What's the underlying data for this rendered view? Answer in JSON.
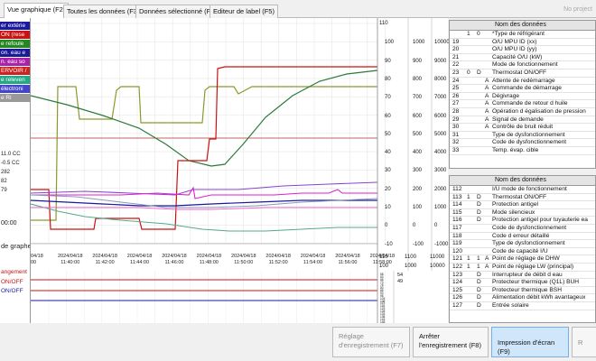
{
  "tabs": [
    {
      "label": "Vue graphique (F2)",
      "active": true
    },
    {
      "label": "Toutes les données (F3)",
      "active": false
    },
    {
      "label": "Données sélectionné (F4)",
      "active": false
    },
    {
      "label": "Editeur de label (F5)",
      "active": false
    }
  ],
  "no_project": "No project",
  "left_legend": [
    {
      "text": "er extérie",
      "color": "#1a1aa0"
    },
    {
      "text": "ON (rese",
      "color": "#cc1111"
    },
    {
      "text": "e refoule",
      "color": "#228822"
    },
    {
      "text": "on. eau e",
      "color": "#1a1a99"
    },
    {
      "text": "n. eau so",
      "color": "#aa22aa"
    },
    {
      "text": "ERVOIR /",
      "color": "#cc2222"
    },
    {
      "text": "e releven",
      "color": "#22aa88"
    },
    {
      "text": "électroni",
      "color": "#4444cc"
    },
    {
      "text": "e Ri",
      "color": "#999999"
    }
  ],
  "left_small": [
    "11.0 CC",
    "-0.5 CC",
    "282",
    "82",
    "79"
  ],
  "left_time": "00:00",
  "left_label": "de graphe",
  "left_bottom": [
    {
      "text": "angement",
      "color": "#cc1111"
    },
    {
      "text": "ON/OFF",
      "color": "#cc1111"
    },
    {
      "text": "ON/OFF",
      "color": "#1a1aa0"
    }
  ],
  "right_axis_1": [
    "110",
    "100",
    "90",
    "80",
    "70",
    "60",
    "50",
    "40",
    "30",
    "20",
    "10",
    "0",
    "-10"
  ],
  "right_axis_2": [
    "110",
    "1100",
    "11000"
  ],
  "right_axis_3": [
    "100",
    "1000",
    "10000"
  ],
  "time_labels": [
    {
      "date": "2024/04/18",
      "time": "11:40:00"
    },
    {
      "date": "2024/04/18",
      "time": "11:42:00"
    },
    {
      "date": "2024/04/18",
      "time": "11:44:00"
    },
    {
      "date": "2024/04/18",
      "time": "11:46:00"
    },
    {
      "date": "2024/04/18",
      "time": "11:48:00"
    },
    {
      "date": "2024/04/18",
      "time": "11:50:00"
    },
    {
      "date": "2024/04/18",
      "time": "11:52:00"
    },
    {
      "date": "2024/04/18",
      "time": "11:54:00"
    },
    {
      "date": "2024/04/18",
      "time": "11:56:00"
    },
    {
      "date": "2024/04/18",
      "time": "11:58:00"
    }
  ],
  "time_left_partial": {
    "date": "04/18",
    "time": "00"
  },
  "lower_axis": [
    "58",
    "63",
    "68",
    "73",
    "78",
    "83",
    "88",
    "93",
    "98",
    "103",
    "108",
    "113",
    "118",
    "123",
    "128",
    "133",
    "138",
    "143",
    "148"
  ],
  "lower_side": [
    "54",
    "49"
  ],
  "table1": {
    "header": "Nom des données",
    "rows": [
      {
        "n": "",
        "a": "1",
        "b": "0",
        "c": "",
        "name": "*Type de réfrigérant"
      },
      {
        "n": "19",
        "a": "",
        "b": "",
        "c": "",
        "name": "O/U MPU ID (xx)"
      },
      {
        "n": "20",
        "a": "",
        "b": "",
        "c": "",
        "name": "O/U MPU ID (yy)"
      },
      {
        "n": "21",
        "a": "",
        "b": "",
        "c": "",
        "name": "Capacité O/U (kW)"
      },
      {
        "n": "22",
        "a": "",
        "b": "",
        "c": "",
        "name": "Mode de fonctionnement"
      },
      {
        "n": "23",
        "a": "0",
        "b": "D",
        "c": "",
        "name": "Thermostat ON/OFF"
      },
      {
        "n": "24",
        "a": "",
        "b": "",
        "c": "A",
        "name": "Attente de redémarrage"
      },
      {
        "n": "25",
        "a": "",
        "b": "",
        "c": "A",
        "name": "Commande de démarrage"
      },
      {
        "n": "26",
        "a": "",
        "b": "",
        "c": "A",
        "name": "Dégivrage"
      },
      {
        "n": "27",
        "a": "",
        "b": "",
        "c": "A",
        "name": "Commande de retour d huile"
      },
      {
        "n": "28",
        "a": "",
        "b": "",
        "c": "A",
        "name": "Opération d égalisation de pression"
      },
      {
        "n": "29",
        "a": "",
        "b": "",
        "c": "A",
        "name": "Signal de demande"
      },
      {
        "n": "30",
        "a": "",
        "b": "",
        "c": "A",
        "name": "Contrôle de bruit réduit"
      },
      {
        "n": "31",
        "a": "",
        "b": "",
        "c": "",
        "name": "Type de dysfonctionnement"
      },
      {
        "n": "32",
        "a": "",
        "b": "",
        "c": "",
        "name": "Code de dysfonctionnement"
      },
      {
        "n": "33",
        "a": "",
        "b": "",
        "c": "",
        "name": "Temp. évap. cible"
      }
    ]
  },
  "table2": {
    "header": "Nom des données",
    "rows": [
      {
        "n": "112",
        "a": "",
        "b": "",
        "c": "",
        "name": "I/U mode de fonctionnement"
      },
      {
        "n": "113",
        "a": "1",
        "b": "D",
        "c": "",
        "name": "Thermostat ON/OFF"
      },
      {
        "n": "114",
        "a": "",
        "b": "D",
        "c": "",
        "name": "Protection antigel"
      },
      {
        "n": "115",
        "a": "",
        "b": "D",
        "c": "",
        "name": "Mode silencieux"
      },
      {
        "n": "116",
        "a": "",
        "b": "D",
        "c": "",
        "name": "Protection antigel pour tuyauterie ea"
      },
      {
        "n": "117",
        "a": "",
        "b": "",
        "c": "",
        "name": "Code de dysfonctionnement"
      },
      {
        "n": "118",
        "a": "",
        "b": "",
        "c": "",
        "name": "Code d erreur détaillé"
      },
      {
        "n": "119",
        "a": "",
        "b": "",
        "c": "",
        "name": "Type de dysfonctionnement"
      },
      {
        "n": "120",
        "a": "",
        "b": "",
        "c": "",
        "name": "Code de capacité I/U"
      },
      {
        "n": "121",
        "a": "1",
        "b": "1",
        "c": "A",
        "name": "Point de réglage de DHW"
      },
      {
        "n": "122",
        "a": "1",
        "b": "1",
        "c": "A",
        "name": "Point de réglage LW (principal)"
      },
      {
        "n": "123",
        "a": "",
        "b": "D",
        "c": "",
        "name": "Interrupteur de débit d eau"
      },
      {
        "n": "124",
        "a": "",
        "b": "D",
        "c": "",
        "name": "Protecteur thermique (Q1L) BUH"
      },
      {
        "n": "125",
        "a": "",
        "b": "D",
        "c": "",
        "name": "Protecteur thermique BSH"
      },
      {
        "n": "126",
        "a": "",
        "b": "D",
        "c": "",
        "name": "Alimentation débit kWh avantageux"
      },
      {
        "n": "127",
        "a": "",
        "b": "D",
        "c": "",
        "name": "Entrée solaire"
      }
    ]
  },
  "buttons": [
    {
      "label": "Réglage d'enregistrement (F7)",
      "state": "disabled"
    },
    {
      "label": "Arrêter l'enregistrement (F8)",
      "state": "normal"
    },
    {
      "label": "Impression d'écran (F9)",
      "state": "primary"
    },
    {
      "label": "R",
      "state": "disabled"
    }
  ],
  "colors": {
    "red": "#cc1111",
    "green": "#2a7a3a",
    "olive": "#8a9a2a",
    "blue": "#1a1aa0",
    "purple": "#8844cc",
    "magenta": "#dd22cc",
    "teal": "#55aa88",
    "grey": "#8899bb"
  }
}
